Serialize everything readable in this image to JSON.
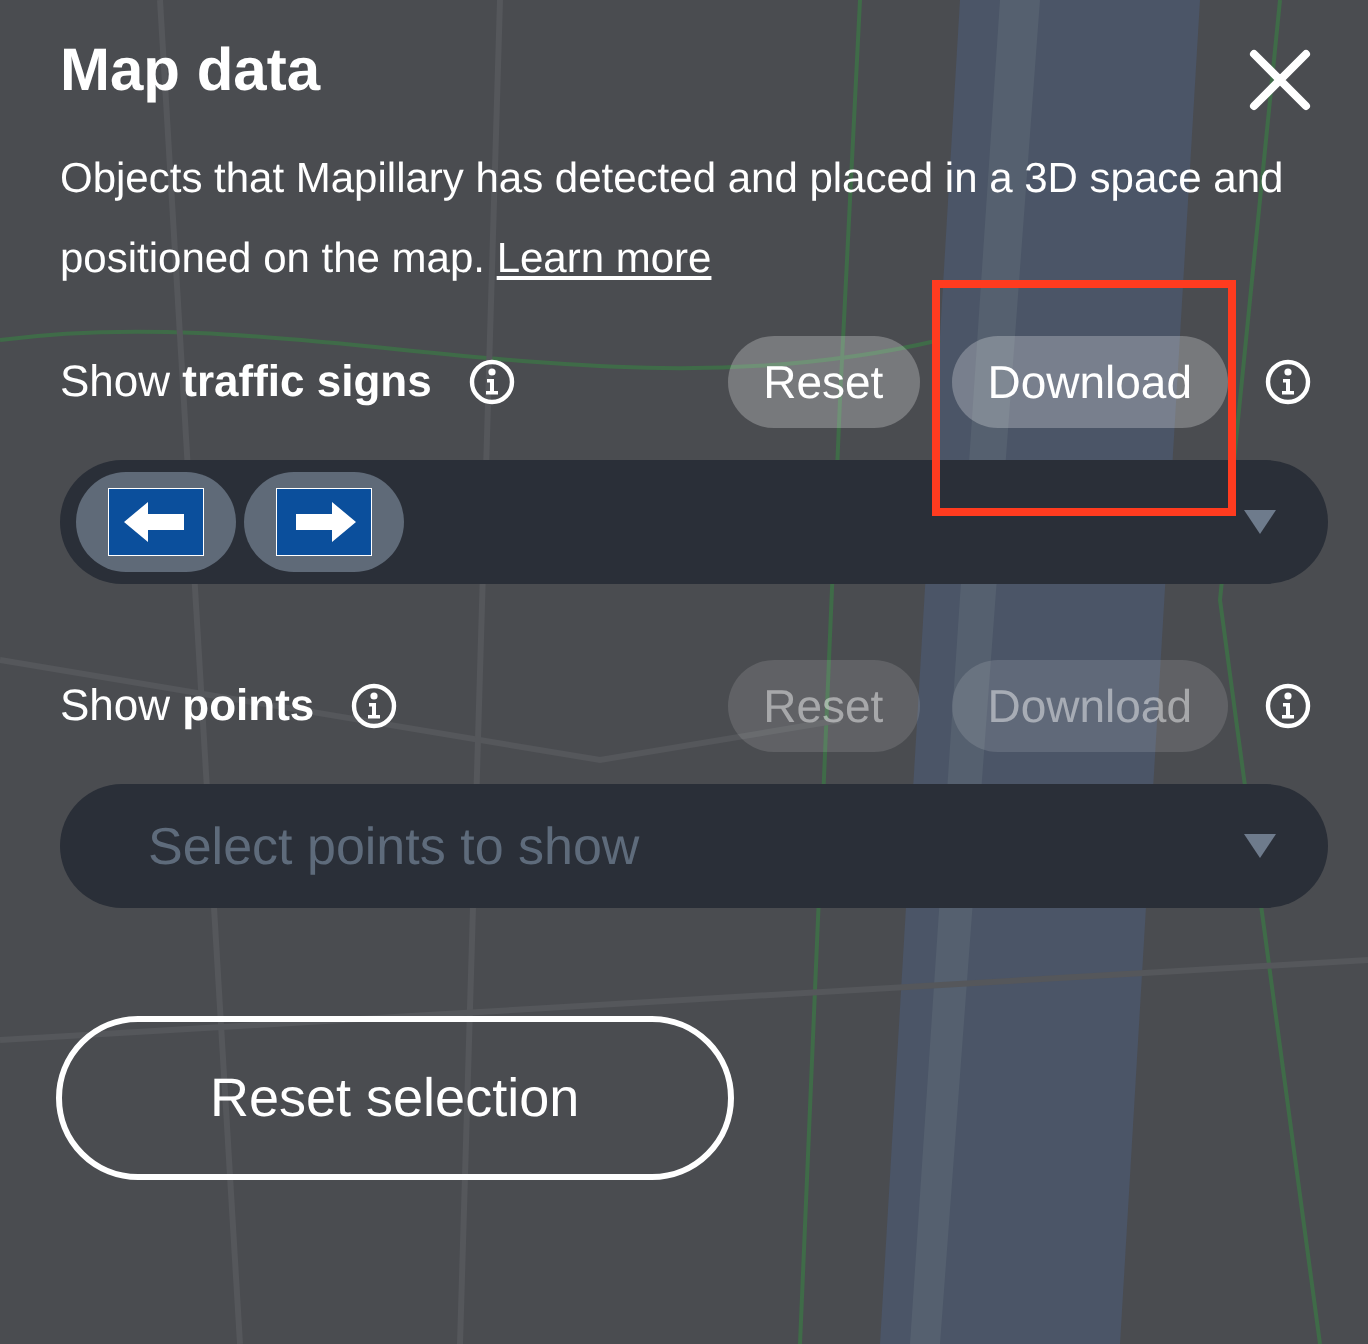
{
  "panel": {
    "title": "Map data",
    "description": "Objects that Mapillary has detected and placed in a 3D space and positioned on the map.",
    "link": "Learn more"
  },
  "sections": [
    {
      "label": "Show **traffic signs**",
      "buttons": [
        {
          "label": "Reset",
          "disabled": false,
          "highlighted": false
        },
        {
          "label": "Download",
          "disabled": false,
          "highlighted": true
        }
      ],
      "select": {
        "chips": [
          {
            "kind": "sign-left"
          },
          {
            "kind": "sign-right"
          }
        ]
      }
    },
    {
      "label": "Show **points**",
      "buttons": [
        {
          "label": "Reset",
          "disabled": true,
          "highlighted": false
        },
        {
          "label": "Download",
          "disabled": true,
          "highlighted": false
        }
      ],
      "select": {
        "placeholder": "Select points to show"
      }
    }
  ],
  "reset_button": "Reset selection"
}
